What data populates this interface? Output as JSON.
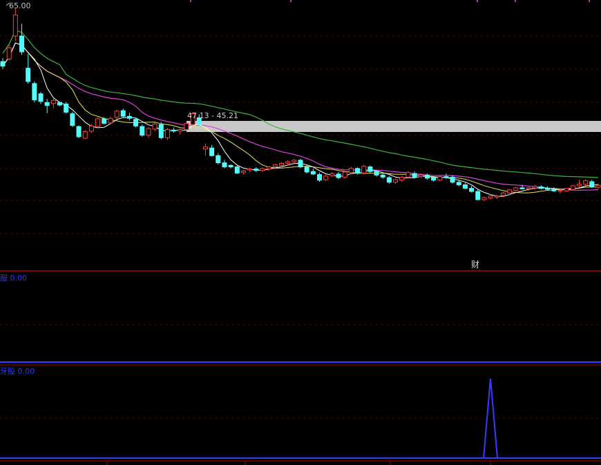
{
  "main_panel": {
    "price_high_label": "65.00",
    "range_annotation": "47.13 - 45.21",
    "event_marker": "财",
    "colors": {
      "up": "#ff4040",
      "down": "#54fcfc",
      "ma_short": "#ffffff",
      "ma_mid": "#e6e64c",
      "ma_long": "#e040e0",
      "ma_xlong": "#3cb43c",
      "band": "#c8c8c8"
    }
  },
  "indicator_panel_1": {
    "label": "服",
    "value": "0.00",
    "color": "#2a3aff"
  },
  "indicator_panel_2": {
    "label": "牙股",
    "value": "0.00",
    "color": "#2a3aff"
  },
  "chart_data": {
    "type": "candlestick",
    "price_max_label": 65.0,
    "ohlc": [
      [
        54.5,
        55.2,
        53.0,
        53.6
      ],
      [
        55.0,
        57.8,
        54.7,
        57.2
      ],
      [
        59.5,
        65.0,
        58.6,
        63.6
      ],
      [
        59.5,
        61.9,
        55.8,
        56.4
      ],
      [
        53.2,
        56.0,
        50.2,
        50.6
      ],
      [
        50.2,
        50.6,
        46.5,
        47.0
      ],
      [
        48.2,
        48.6,
        46.2,
        46.7
      ],
      [
        46.5,
        47.2,
        44.4,
        45.9
      ],
      [
        46.3,
        47.4,
        45.3,
        46.9
      ],
      [
        46.5,
        46.7,
        45.8,
        46.0
      ],
      [
        46.2,
        46.6,
        44.3,
        44.6
      ],
      [
        44.3,
        44.7,
        41.7,
        42.0
      ],
      [
        41.8,
        42.0,
        39.5,
        39.8
      ],
      [
        39.5,
        41.1,
        39.3,
        40.8
      ],
      [
        40.9,
        42.3,
        40.5,
        41.9
      ],
      [
        41.8,
        43.6,
        41.5,
        43.3
      ],
      [
        43.3,
        43.6,
        42.2,
        42.4
      ],
      [
        42.5,
        43.7,
        42.2,
        43.4
      ],
      [
        43.6,
        45.1,
        43.3,
        44.8
      ],
      [
        44.9,
        45.3,
        43.6,
        43.8
      ],
      [
        43.8,
        44.5,
        43.0,
        43.4
      ],
      [
        43.2,
        43.5,
        41.6,
        41.9
      ],
      [
        41.8,
        42.2,
        39.8,
        40.1
      ],
      [
        40.1,
        41.7,
        39.6,
        41.4
      ],
      [
        41.3,
        42.6,
        40.9,
        42.3
      ],
      [
        42.2,
        42.7,
        39.3,
        39.6
      ],
      [
        39.6,
        41.5,
        39.2,
        41.2
      ],
      [
        41.1,
        41.6,
        40.6,
        40.9
      ],
      [
        40.9,
        41.5,
        40.2,
        41.2
      ],
      [
        41.2,
        42.6,
        40.9,
        42.4
      ],
      [
        42.2,
        44.6,
        41.9,
        44.3
      ],
      [
        43.5,
        44.2,
        41.9,
        42.2
      ],
      [
        37.4,
        38.5,
        36.1,
        37.8
      ],
      [
        37.6,
        38.2,
        35.9,
        36.1
      ],
      [
        36.1,
        36.6,
        34.4,
        34.7
      ],
      [
        34.7,
        35.3,
        33.6,
        33.9
      ],
      [
        34.2,
        34.4,
        33.6,
        33.9
      ],
      [
        33.9,
        34.2,
        32.5,
        32.7
      ],
      [
        32.8,
        33.3,
        32.4,
        33.1
      ],
      [
        33.3,
        33.7,
        32.8,
        33.5
      ],
      [
        33.5,
        33.8,
        32.9,
        33.2
      ],
      [
        33.2,
        33.8,
        32.9,
        33.6
      ],
      [
        33.5,
        34.1,
        33.1,
        33.9
      ],
      [
        33.9,
        34.5,
        33.5,
        34.3
      ],
      [
        34.2,
        34.8,
        33.8,
        34.6
      ],
      [
        34.6,
        35.2,
        34.2,
        34.9
      ],
      [
        34.9,
        35.5,
        34.4,
        35.2
      ],
      [
        35.2,
        35.5,
        33.6,
        33.9
      ],
      [
        33.9,
        34.2,
        32.6,
        32.9
      ],
      [
        33.0,
        33.6,
        32.3,
        32.5
      ],
      [
        32.4,
        32.8,
        31.0,
        31.3
      ],
      [
        31.4,
        32.4,
        31.1,
        32.1
      ],
      [
        32.2,
        32.9,
        31.9,
        32.6
      ],
      [
        32.5,
        32.9,
        31.5,
        31.8
      ],
      [
        31.9,
        33.2,
        31.6,
        32.9
      ],
      [
        32.8,
        33.9,
        32.5,
        33.6
      ],
      [
        33.6,
        33.8,
        32.4,
        32.7
      ],
      [
        32.7,
        34.3,
        32.4,
        34.0
      ],
      [
        33.9,
        34.2,
        32.7,
        33.0
      ],
      [
        33.1,
        33.3,
        32.0,
        32.3
      ],
      [
        32.3,
        32.8,
        31.6,
        31.9
      ],
      [
        31.8,
        32.1,
        30.6,
        30.9
      ],
      [
        30.9,
        31.6,
        30.6,
        31.4
      ],
      [
        31.3,
        32.2,
        31.0,
        31.9
      ],
      [
        31.9,
        33.1,
        31.7,
        32.8
      ],
      [
        32.6,
        33.0,
        31.6,
        31.9
      ],
      [
        32.0,
        32.6,
        31.7,
        32.3
      ],
      [
        32.3,
        32.6,
        31.4,
        31.7
      ],
      [
        31.8,
        32.1,
        31.0,
        31.3
      ],
      [
        31.3,
        32.3,
        31.1,
        32.0
      ],
      [
        32.0,
        32.6,
        31.5,
        31.8
      ],
      [
        31.9,
        32.3,
        30.6,
        30.9
      ],
      [
        30.9,
        31.3,
        30.1,
        30.4
      ],
      [
        30.4,
        30.8,
        29.5,
        29.7
      ],
      [
        29.7,
        30.2,
        28.9,
        29.1
      ],
      [
        29.1,
        29.5,
        27.3,
        27.5
      ],
      [
        27.5,
        28.1,
        27.2,
        27.9
      ],
      [
        27.8,
        28.5,
        27.5,
        28.2
      ],
      [
        28.0,
        28.5,
        27.6,
        28.2
      ],
      [
        28.3,
        29.0,
        28.0,
        28.8
      ],
      [
        28.8,
        29.6,
        28.4,
        29.4
      ],
      [
        29.3,
        30.0,
        29.0,
        29.8
      ],
      [
        29.8,
        30.4,
        29.5,
        29.6
      ],
      [
        29.6,
        30.0,
        29.2,
        29.8
      ],
      [
        29.8,
        30.4,
        29.4,
        30.1
      ],
      [
        30.0,
        30.3,
        29.5,
        29.7
      ],
      [
        29.7,
        30.1,
        29.3,
        29.5
      ],
      [
        29.5,
        29.9,
        29.0,
        29.2
      ],
      [
        29.2,
        29.6,
        28.7,
        29.3
      ],
      [
        29.2,
        29.8,
        29.0,
        29.7
      ],
      [
        29.5,
        30.4,
        29.3,
        30.2
      ],
      [
        30.2,
        31.4,
        29.8,
        30.5
      ],
      [
        30.5,
        31.5,
        30.2,
        31.2
      ],
      [
        31.0,
        31.4,
        29.8,
        30.0
      ],
      [
        29.9,
        30.6,
        29.6,
        30.3
      ]
    ],
    "spike_panel_event_index": 81
  }
}
